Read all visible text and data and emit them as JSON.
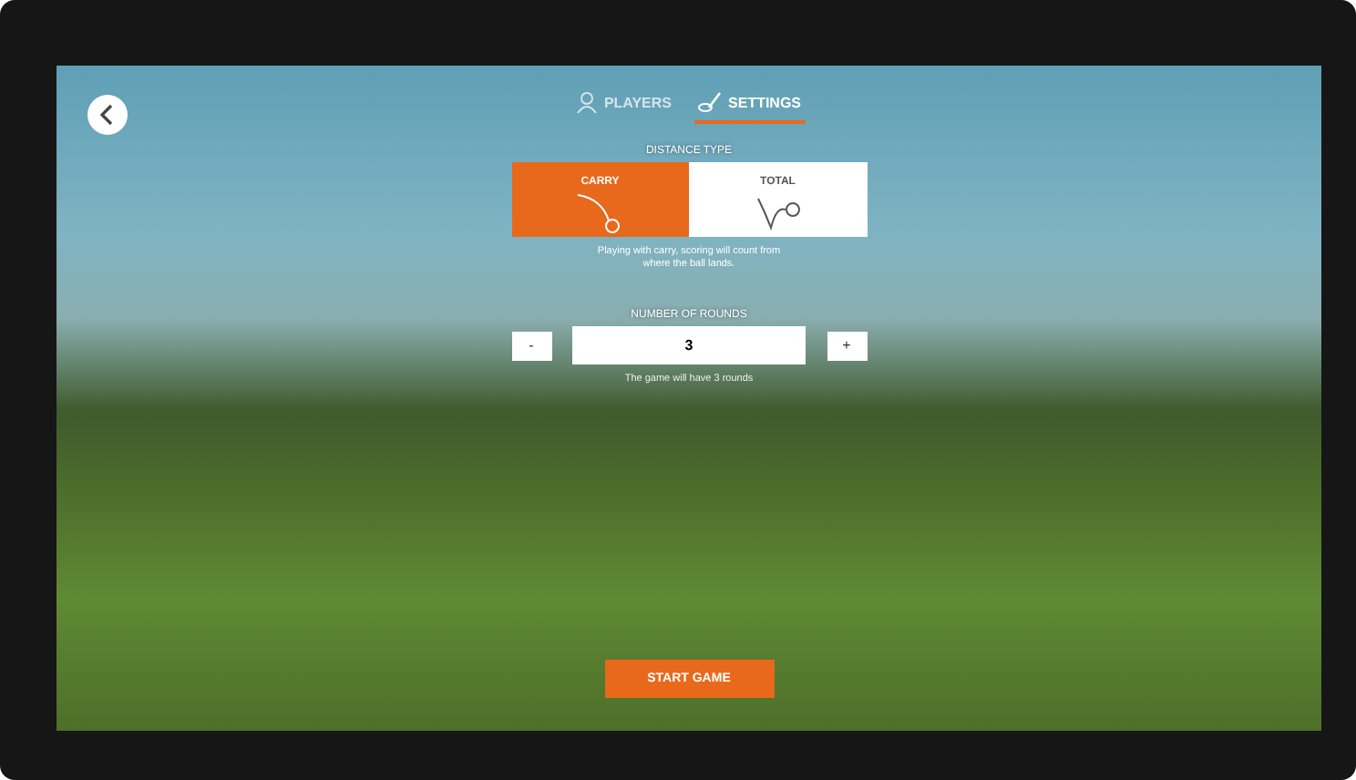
{
  "tabs": [
    {
      "label": "PLAYERS",
      "selected": false,
      "kind": "players"
    },
    {
      "label": "SETTINGS",
      "selected": true,
      "kind": "settings"
    }
  ],
  "distance_type": {
    "label": "DISTANCE TYPE",
    "options": [
      {
        "label": "CARRY",
        "selected": true,
        "kind": "carry"
      },
      {
        "label": "TOTAL",
        "selected": false,
        "kind": "total"
      }
    ],
    "description": "Playing with carry, scoring will count from where the ball lands."
  },
  "rounds": {
    "label": "NUMBER OF ROUNDS",
    "decrement": "-",
    "value": "3",
    "increment": "+",
    "hint": "The game will have 3 rounds"
  },
  "start_button": "START GAME"
}
